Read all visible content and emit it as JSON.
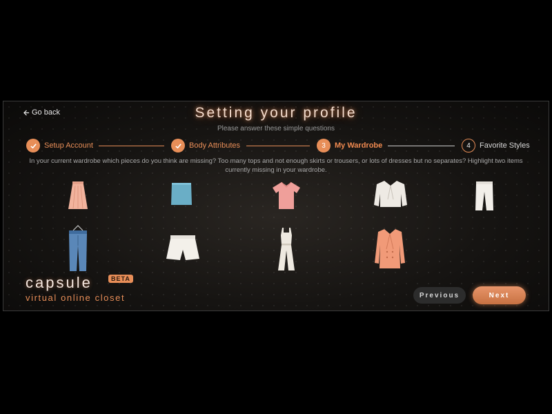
{
  "nav": {
    "back_label": "Go back"
  },
  "header": {
    "title": "Setting your profile",
    "subtitle": "Please answer these simple questions"
  },
  "steps": [
    {
      "number": "1",
      "label": "Setup Account",
      "state": "completed"
    },
    {
      "number": "2",
      "label": "Body Attributes",
      "state": "completed"
    },
    {
      "number": "3",
      "label": "My Wardrobe",
      "state": "active"
    },
    {
      "number": "4",
      "label": "Favorite Styles",
      "state": "pending"
    }
  ],
  "question": "In your current wardrobe which pieces do you think are missing? Too many tops and not enough skirts or trousers, or lots of dresses but no separates? Highlight two items currently missing in your wardrobe.",
  "wardrobe_items": [
    {
      "icon": "pink-skirt-icon"
    },
    {
      "icon": "blue-crop-top-icon"
    },
    {
      "icon": "pink-tshirt-icon"
    },
    {
      "icon": "white-blazer-icon"
    },
    {
      "icon": "white-trousers-icon"
    },
    {
      "icon": "blue-jeans-icon"
    },
    {
      "icon": "white-shorts-icon"
    },
    {
      "icon": "white-jumpsuit-icon"
    },
    {
      "icon": "pink-coat-icon"
    }
  ],
  "brand": {
    "name": "capsule",
    "badge": "BETA",
    "tagline": "virtual online closet"
  },
  "buttons": {
    "previous": "Previous",
    "next": "Next"
  },
  "colors": {
    "accent": "#e88e58",
    "background": "#000000",
    "panel": "#161412"
  }
}
